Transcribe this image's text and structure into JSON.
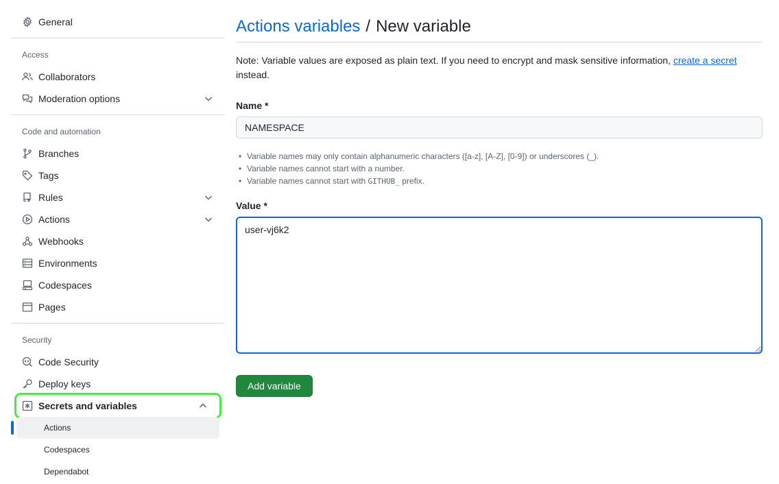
{
  "sidebar": {
    "general": {
      "label": "General",
      "icon": "gear-icon"
    },
    "access": {
      "heading": "Access",
      "items": [
        {
          "label": "Collaborators",
          "icon": "people-icon",
          "expandable": false
        },
        {
          "label": "Moderation options",
          "icon": "comment-discussion-icon",
          "expandable": true
        }
      ]
    },
    "code_automation": {
      "heading": "Code and automation",
      "items": [
        {
          "label": "Branches",
          "icon": "git-branch-icon",
          "expandable": false
        },
        {
          "label": "Tags",
          "icon": "tag-icon",
          "expandable": false
        },
        {
          "label": "Rules",
          "icon": "repo-push-icon",
          "expandable": true
        },
        {
          "label": "Actions",
          "icon": "play-icon",
          "expandable": true
        },
        {
          "label": "Webhooks",
          "icon": "webhook-icon",
          "expandable": false
        },
        {
          "label": "Environments",
          "icon": "server-icon",
          "expandable": false
        },
        {
          "label": "Codespaces",
          "icon": "codespaces-icon",
          "expandable": false
        },
        {
          "label": "Pages",
          "icon": "browser-icon",
          "expandable": false
        }
      ]
    },
    "security": {
      "heading": "Security",
      "items": [
        {
          "label": "Code Security",
          "icon": "codescan-icon"
        },
        {
          "label": "Deploy keys",
          "icon": "key-icon"
        }
      ],
      "secrets": {
        "label": "Secrets and variables",
        "icon": "asterisk-icon",
        "sub_items": [
          {
            "label": "Actions",
            "active": true
          },
          {
            "label": "Codespaces",
            "active": false
          },
          {
            "label": "Dependabot",
            "active": false
          }
        ]
      }
    }
  },
  "main": {
    "breadcrumb_link": "Actions variables",
    "breadcrumb_sep": "/",
    "breadcrumb_current": "New variable",
    "note_prefix": "Note: Variable values are exposed as plain text. If you need to encrypt and mask sensitive information,",
    "note_link": "create a secret",
    "note_suffix": "instead.",
    "name_label": "Name *",
    "name_value": "NAMESPACE",
    "hints": [
      "Variable names may only contain alphanumeric characters ([a-z], [A-Z], [0-9]) or underscores (_).",
      "Variable names cannot start with a number.",
      "Variable names cannot start with"
    ],
    "hint_code": "GITHUB_",
    "hint_suffix": "prefix.",
    "value_label": "Value *",
    "value_text": "user-vj6k2",
    "submit_label": "Add variable"
  },
  "colors": {
    "link": "#0969da",
    "button_green": "#1f883d",
    "highlight_green": "#3cf23c",
    "muted": "#59636e"
  }
}
